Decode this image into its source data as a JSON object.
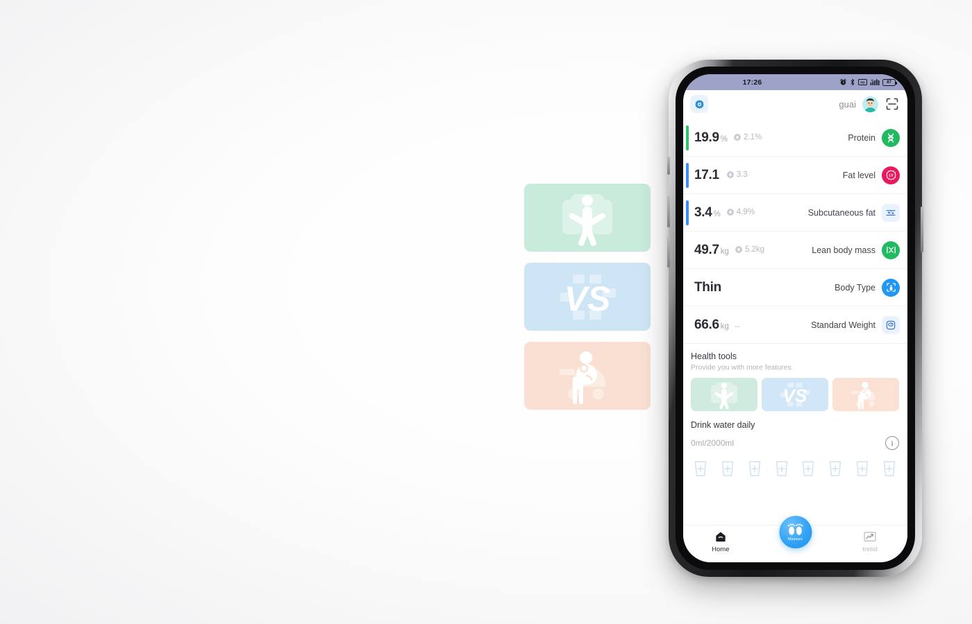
{
  "statusbar": {
    "time": "17:26",
    "battery_level": "87",
    "icons": [
      "alarm-icon",
      "bluetooth-icon",
      "hd-icon",
      "signal-icon",
      "battery-icon"
    ]
  },
  "header": {
    "settings_icon": "gear-icon",
    "user_name": "guai",
    "avatar": "user-avatar",
    "scan_icon": "scan-icon"
  },
  "metrics": [
    {
      "value": "19.9",
      "unit": "%",
      "delta": "2.1%",
      "trend": "up",
      "label": "Protein",
      "icon": "dna-icon",
      "accent": "#2ec26a",
      "icon_bg": "#23b862",
      "icon_style": "solid",
      "bar": true
    },
    {
      "value": "17.1",
      "unit": "",
      "delta": "3.3",
      "trend": "down",
      "label": "Fat level",
      "icon": "level-badge-icon",
      "accent": "#3c8ef5",
      "icon_bg": "#e8195f",
      "icon_style": "solid",
      "bar": true
    },
    {
      "value": "3.4",
      "unit": "%",
      "delta": "4.9%",
      "trend": "down",
      "label": "Subcutaneous fat",
      "icon": "fat-cells-icon",
      "accent": "#3c8ef5",
      "icon_bg": "#eaf2fd",
      "icon_style": "soft",
      "bar": true
    },
    {
      "value": "49.7",
      "unit": "kg",
      "delta": "5.2kg",
      "trend": "down",
      "label": "Lean body mass",
      "icon": "muscle-icon",
      "accent": "",
      "icon_bg": "#23b862",
      "icon_style": "solid",
      "bar": false
    },
    {
      "value": "Thin",
      "unit": "",
      "delta": "",
      "trend": "",
      "label": "Body Type",
      "icon": "body-scan-icon",
      "accent": "",
      "icon_bg": "#2196f3",
      "icon_style": "solid",
      "bar": false
    },
    {
      "value": "66.6",
      "unit": "kg",
      "delta": "--",
      "trend": "none",
      "label": "Standard Weight",
      "icon": "weight-scale-icon",
      "accent": "",
      "icon_bg": "#eaf2fd",
      "icon_style": "soft",
      "bar": false
    }
  ],
  "health_tools": {
    "title": "Health tools",
    "subtitle": "Provide you with more features",
    "cards": [
      {
        "name": "body-measure-tool",
        "icon": "person-measure-icon",
        "color": "#cfeadf"
      },
      {
        "name": "compare-tool",
        "icon": "vs-icon",
        "color": "#d1e6f6"
      },
      {
        "name": "pregnancy-tool",
        "icon": "pregnancy-icon",
        "color": "#fae1d4"
      }
    ]
  },
  "water": {
    "title": "Drink water daily",
    "amount": "0ml/2000ml",
    "info_icon": "info-icon",
    "glass_count": 8,
    "glass_icon": "water-glass-add-icon"
  },
  "bottom_nav": {
    "items": [
      {
        "label": "Home",
        "icon": "home-scale-icon",
        "active": true
      },
      {
        "label": "Measure",
        "icon": "footprints-icon",
        "active": true
      },
      {
        "label": "trend",
        "icon": "trend-chart-icon",
        "active": false
      }
    ]
  },
  "promo_cards": [
    {
      "name": "body-measure-promo",
      "icon": "person-measure-icon",
      "color": "#c9ebdc"
    },
    {
      "name": "compare-promo",
      "icon": "vs-icon",
      "color": "#cee5f5"
    },
    {
      "name": "pregnancy-promo",
      "icon": "pregnancy-icon",
      "color": "#fae0d2"
    }
  ],
  "colors": {
    "statusbar_bg": "#9ea2c9",
    "green": "#23b862",
    "blue": "#2196f3",
    "pink": "#e8195f",
    "accent_green": "#2ec26a",
    "accent_blue": "#3c8ef5"
  }
}
